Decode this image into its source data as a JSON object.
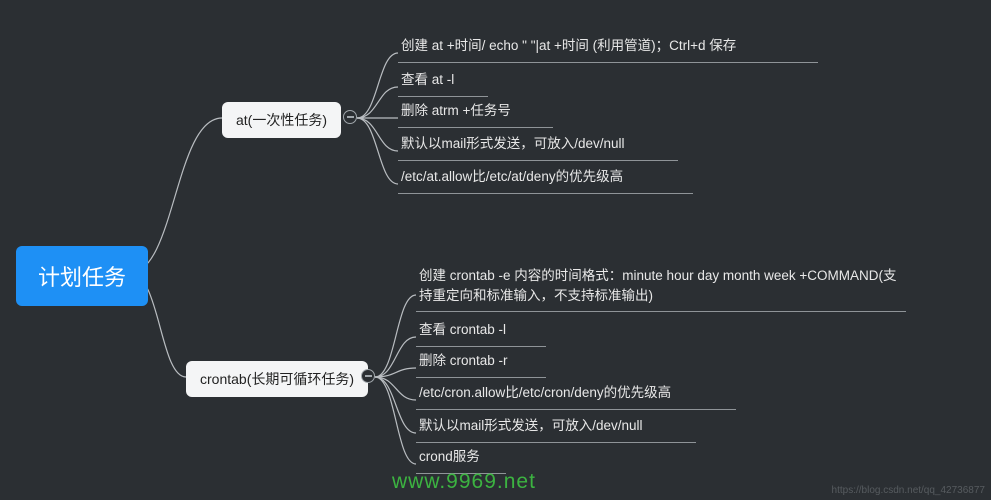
{
  "root": {
    "label": "计划任务"
  },
  "at": {
    "label": "at(一次性任务)",
    "items": [
      "创建 at +时间/ echo \" \"|at +时间 (利用管道)；Ctrl+d 保存",
      "查看 at -l",
      "删除 atrm +任务号",
      "默认以mail形式发送，可放入/dev/null",
      "/etc/at.allow比/etc/at/deny的优先级高"
    ]
  },
  "crontab": {
    "label": "crontab(长期可循环任务)",
    "items": [
      "创建 crontab -e 内容的时间格式：minute hour day month week +COMMAND(支持重定向和标准输入，不支持标准输出)",
      "查看 crontab -l",
      "删除 crontab -r",
      "/etc/cron.allow比/etc/cron/deny的优先级高",
      "默认以mail形式发送，可放入/dev/null",
      "crond服务"
    ]
  },
  "watermarks": {
    "center": "www.9969.net",
    "br": "https://blog.csdn.net/qq_42736877"
  },
  "chart_data": {
    "type": "tree",
    "root": "计划任务",
    "children": [
      {
        "label": "at(一次性任务)",
        "children": [
          "创建 at +时间/ echo \" \"|at +时间 (利用管道)；Ctrl+d 保存",
          "查看 at -l",
          "删除 atrm +任务号",
          "默认以mail形式发送，可放入/dev/null",
          "/etc/at.allow比/etc/at/deny的优先级高"
        ]
      },
      {
        "label": "crontab(长期可循环任务)",
        "children": [
          "创建 crontab -e 内容的时间格式：minute hour day month week +COMMAND(支持重定向和标准输入，不支持标准输出)",
          "查看 crontab -l",
          "删除 crontab -r",
          "/etc/cron.allow比/etc/cron/deny的优先级高",
          "默认以mail形式发送，可放入/dev/null",
          "crond服务"
        ]
      }
    ]
  }
}
